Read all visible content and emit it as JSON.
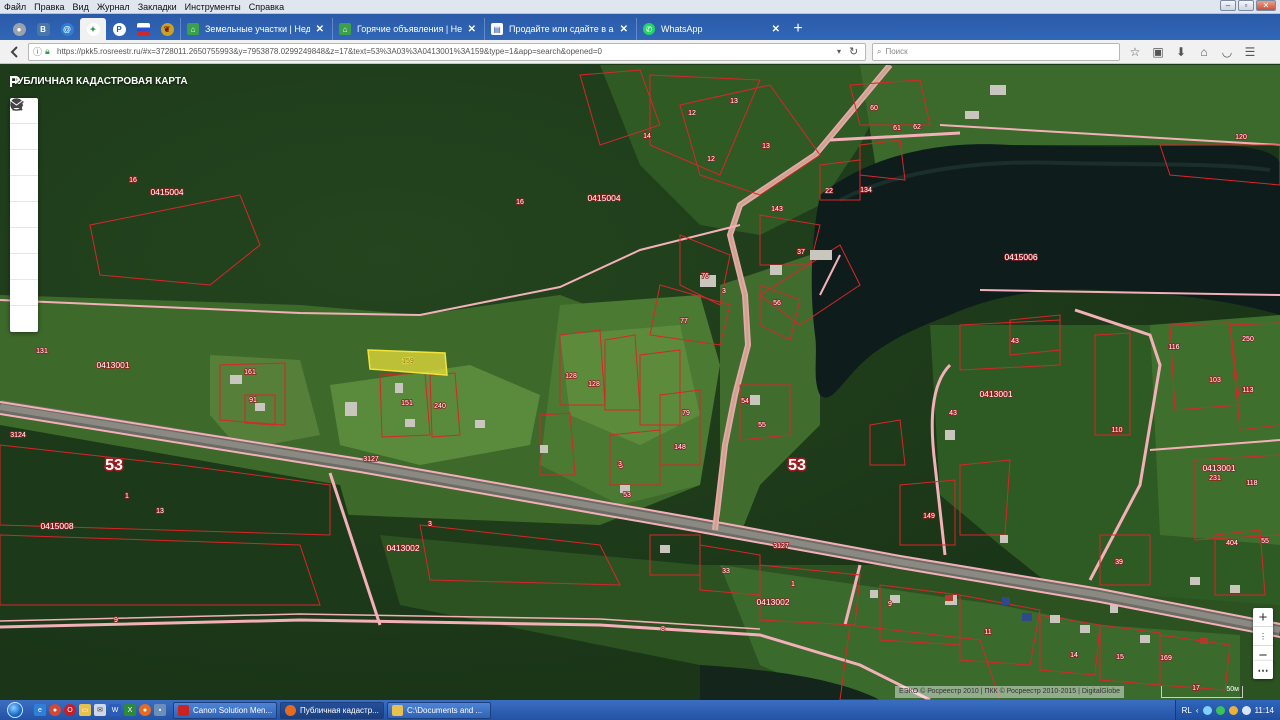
{
  "browser": {
    "menu": [
      "Файл",
      "Правка",
      "Вид",
      "Журнал",
      "Закладки",
      "Инструменты",
      "Справка"
    ],
    "tabs": [
      {
        "title": "Земельные участки | Недви...",
        "icon": "home-icon"
      },
      {
        "title": "Горячие объявления | Недв...",
        "icon": "home-icon"
      },
      {
        "title": "Продайте или сдайте в аре...",
        "icon": "page-icon"
      },
      {
        "title": "WhatsApp",
        "icon": "whatsapp-icon"
      }
    ],
    "url": "https://pkk5.rosreestr.ru/#x=3728011.2650755993&y=7953878.0299249848&z=17&text=53%3A03%3A0413001%3A159&type=1&app=search&opened=0",
    "url_domain": "pkk5.rosreestr.ru",
    "search_placeholder": "Поиск"
  },
  "map": {
    "title": "ПУБЛИЧНАЯ КАДАСТРОВАЯ КАРТА",
    "attribution": "ЕЭКО © Росреестр 2010 | ПКК © Росреестр 2010-2015 | DigitalGlobe",
    "scale_label": "50м",
    "highlighted_parcel": "159",
    "region_labels": [
      "53",
      "53"
    ],
    "quarter_labels": [
      "0415004",
      "0415004",
      "0415006",
      "0413001",
      "0413001",
      "0413001",
      "0415008",
      "0413002",
      "0413002"
    ],
    "parcel_labels": [
      "16",
      "16",
      "14",
      "12",
      "13",
      "13",
      "12",
      "60",
      "62",
      "61",
      "120",
      "143",
      "22",
      "134",
      "37",
      "76",
      "3",
      "77",
      "56",
      "161",
      "91",
      "131",
      "159",
      "151",
      "240",
      "128",
      "128",
      "3",
      "54",
      "79",
      "148",
      "55",
      "53",
      "43",
      "43",
      "149",
      "110",
      "116",
      "103",
      "113",
      "250",
      "231",
      "118",
      "404",
      "55",
      "33",
      "39",
      "3",
      "1",
      "9",
      "11",
      "14",
      "15",
      "169",
      "17",
      "13",
      "1",
      "3",
      "9",
      "8",
      "3124",
      "3127",
      "3127"
    ],
    "toolbar": [
      "search-icon",
      "info-icon",
      "layers-icon",
      "draw-icon",
      "measure-icon",
      "bookmark-icon",
      "print-icon",
      "help-icon",
      "mail-icon"
    ]
  },
  "taskbar": {
    "items": [
      {
        "label": "Canon Solution Men..."
      },
      {
        "label": "Публичная кадастр..."
      },
      {
        "label": "C:\\Documents and ..."
      }
    ],
    "lang": "RL",
    "time": "11:14"
  }
}
